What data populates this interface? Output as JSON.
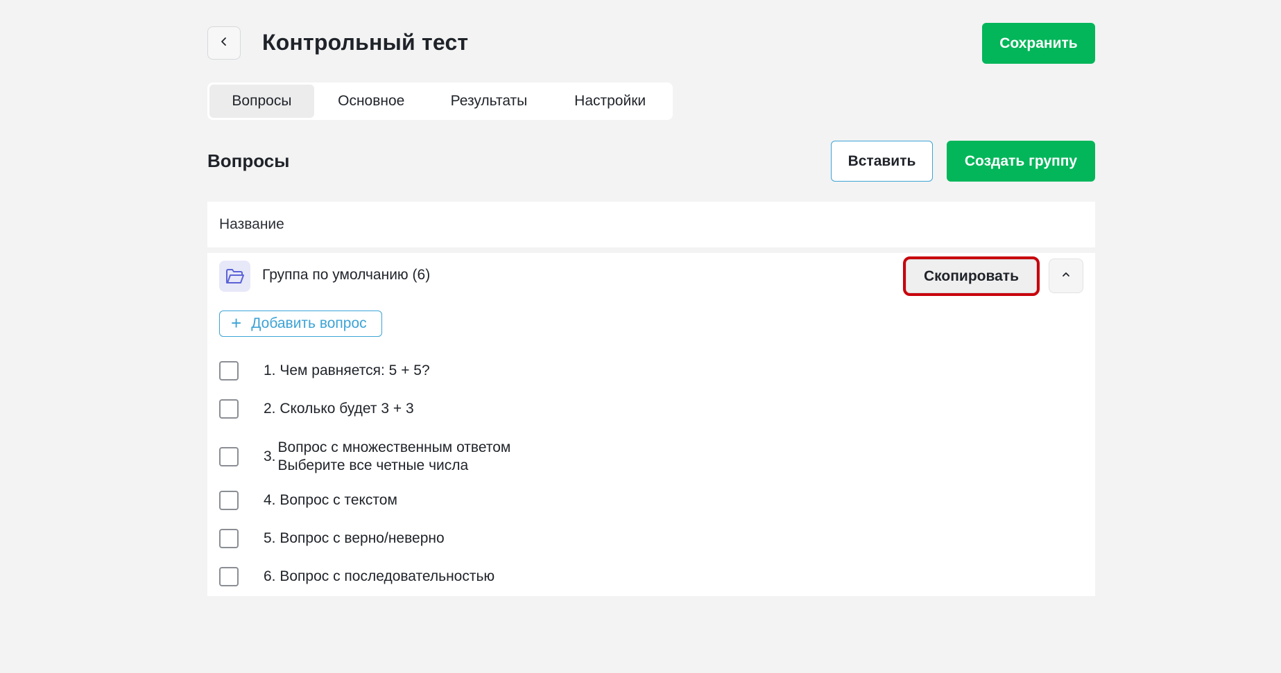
{
  "header": {
    "title": "Контрольный тест",
    "save_label": "Сохранить",
    "back_icon": "chevron-left-icon"
  },
  "tabs": [
    {
      "label": "Вопросы",
      "active": true
    },
    {
      "label": "Основное",
      "active": false
    },
    {
      "label": "Результаты",
      "active": false
    },
    {
      "label": "Настройки",
      "active": false
    }
  ],
  "section": {
    "title": "Вопросы",
    "paste_label": "Вставить",
    "create_group_label": "Создать группу"
  },
  "table": {
    "column_header": "Название"
  },
  "group": {
    "title": "Группа по умолчанию (6)",
    "icon": "folder-open-icon",
    "copy_label": "Скопировать",
    "collapse_icon": "chevron-up-icon",
    "add_question_label": "Добавить вопрос",
    "questions": [
      {
        "text": "1. Чем равняется: 5 + 5?"
      },
      {
        "text": "2. Сколько будет 3 + 3"
      },
      {
        "number": "3.",
        "line1": "Вопрос с множественным ответом",
        "line2": "Выберите все четные числа"
      },
      {
        "text": "4. Вопрос с текстом"
      },
      {
        "text": "5. Вопрос с верно/неверно"
      },
      {
        "text": "6. Вопрос с последовательностью"
      }
    ]
  },
  "colors": {
    "accent_green": "#03b65a",
    "accent_blue": "#3ca3d6",
    "highlight_red": "#c8000b",
    "background": "#f3f3f3"
  }
}
